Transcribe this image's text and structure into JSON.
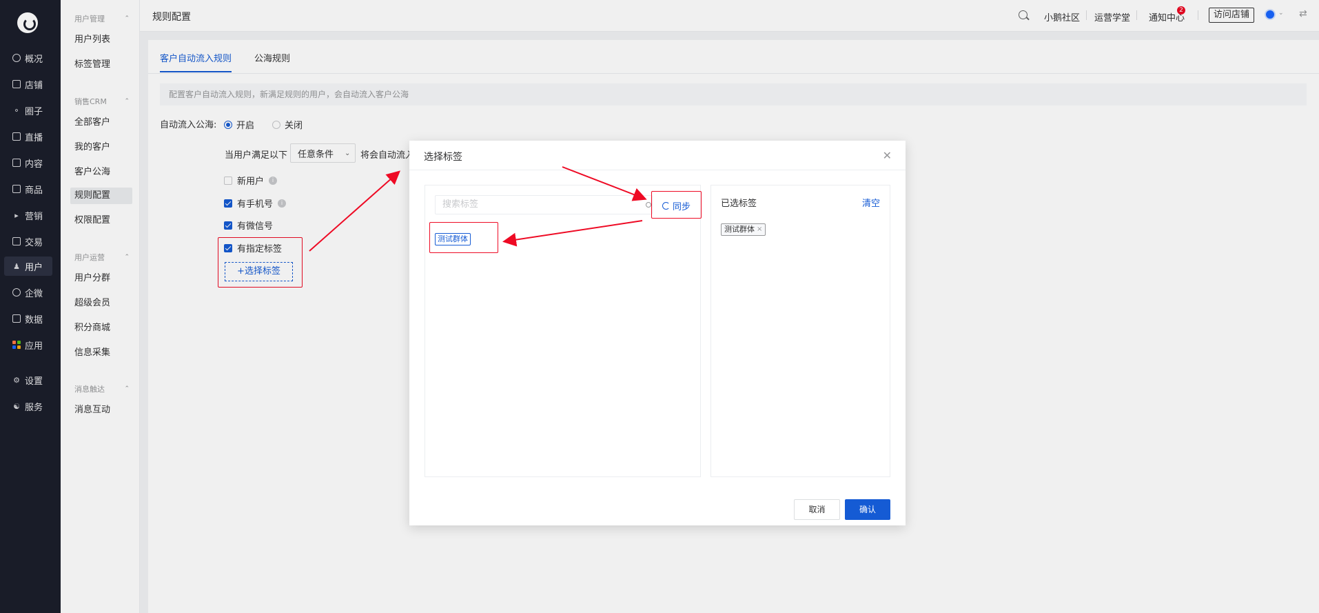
{
  "nav": {
    "items": [
      {
        "label": "概况",
        "icon": "pie-chart-icon"
      },
      {
        "label": "店铺",
        "icon": "store-icon"
      },
      {
        "label": "圈子",
        "icon": "community-icon"
      },
      {
        "label": "直播",
        "icon": "live-icon"
      },
      {
        "label": "内容",
        "icon": "document-icon"
      },
      {
        "label": "商品",
        "icon": "goods-icon"
      },
      {
        "label": "营销",
        "icon": "megaphone-icon"
      },
      {
        "label": "交易",
        "icon": "trade-icon"
      },
      {
        "label": "用户",
        "icon": "user-icon"
      },
      {
        "label": "企微",
        "icon": "wechat-work-icon"
      },
      {
        "label": "数据",
        "icon": "data-icon"
      },
      {
        "label": "应用",
        "icon": "apps-grid-icon"
      },
      {
        "label": "设置",
        "icon": "gear-icon"
      },
      {
        "label": "服务",
        "icon": "service-icon"
      }
    ]
  },
  "subnav": {
    "groups": [
      {
        "title": "用户管理",
        "items": [
          "用户列表",
          "标签管理"
        ]
      },
      {
        "title": "销售CRM",
        "items": [
          "全部客户",
          "我的客户",
          "客户公海",
          "规则配置",
          "权限配置"
        ]
      },
      {
        "title": "用户运营",
        "items": [
          "用户分群",
          "超级会员",
          "积分商城",
          "信息采集"
        ]
      },
      {
        "title": "消息触达",
        "items": [
          "消息互动"
        ]
      }
    ]
  },
  "header": {
    "title": "规则配置",
    "links": [
      "小鹅社区",
      "运营学堂",
      "通知中心"
    ],
    "notification_count": "2",
    "visit_store": "访问店铺"
  },
  "main": {
    "tabs": [
      "客户自动流入规则",
      "公海规则"
    ],
    "notice": "配置客户自动流入规则，新满足规则的用户，会自动流入客户公海",
    "auto_flow_label": "自动流入公海:",
    "radio_on": "开启",
    "radio_off": "关闭",
    "condition_prefix": "当用户满足以下",
    "condition_select": "任意条件",
    "condition_suffix": "将会自动流入",
    "checks": [
      {
        "label": "新用户",
        "checked": false
      },
      {
        "label": "有手机号",
        "checked": true
      },
      {
        "label": "有微信号",
        "checked": true
      },
      {
        "label": "有指定标签",
        "checked": true
      }
    ],
    "add_tag_button": "+选择标签"
  },
  "modal": {
    "title": "选择标签",
    "search_placeholder": "搜索标签",
    "sync_label": "同步",
    "tags": [
      "测试群体"
    ],
    "selected_title": "已选标签",
    "clear_label": "清空",
    "selected_tags": [
      "测试群体"
    ],
    "cancel_label": "取消",
    "confirm_label": "确认"
  },
  "colors": {
    "primary": "#155bd4",
    "nav_bg": "#1b1e2b",
    "annotation_red": "#ee0a24"
  }
}
